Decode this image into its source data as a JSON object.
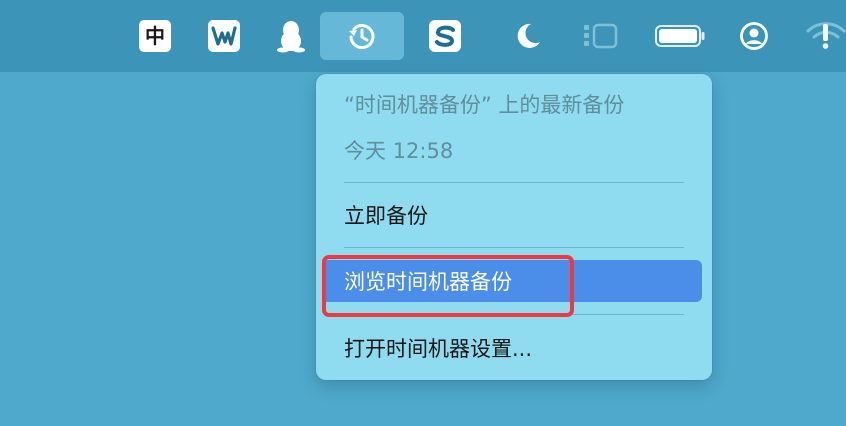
{
  "menubar": {
    "input_method": {
      "label": "中",
      "icon": "chinese-input-method-icon"
    },
    "items": [
      {
        "name": "wps-office-icon"
      },
      {
        "name": "qq-penguin-icon"
      },
      {
        "name": "time-machine-icon",
        "active": true
      },
      {
        "name": "sogou-input-icon"
      },
      {
        "name": "moon-focus-icon"
      },
      {
        "name": "stage-manager-icon"
      },
      {
        "name": "battery-icon"
      },
      {
        "name": "user-account-icon"
      },
      {
        "name": "wifi-alert-icon"
      }
    ],
    "background_color": "#3c95b8",
    "active_item_color": "#65b8d8"
  },
  "time_machine_menu": {
    "latest_backup_heading": "“时间机器备份” 上的最新备份",
    "latest_backup_time": "今天 12:58",
    "items": [
      {
        "label": "立即备份",
        "highlighted": false
      },
      {
        "label": "浏览时间机器备份",
        "highlighted": true
      },
      {
        "label": "打开时间机器设置...",
        "highlighted": false
      }
    ],
    "highlight_color": "#4b8eea",
    "menu_background": "#8fdcf0"
  },
  "annotation": {
    "color": "#ee3a3f"
  }
}
